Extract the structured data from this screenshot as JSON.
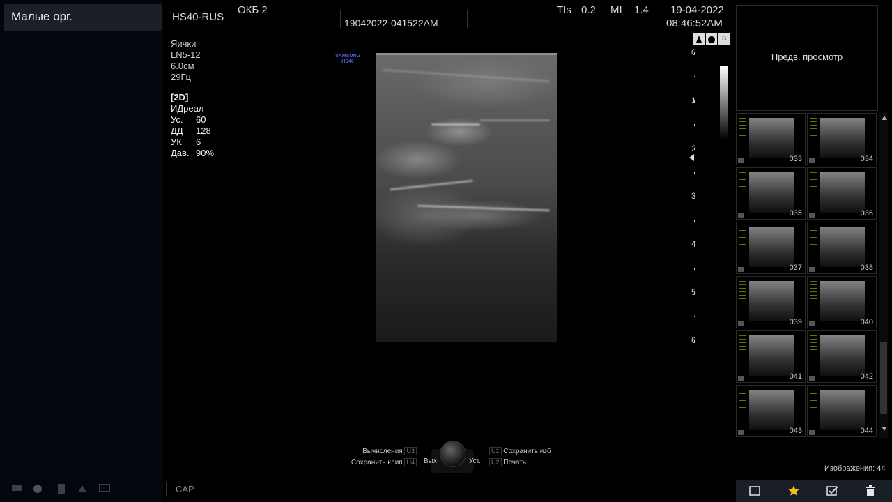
{
  "preset": "Малые орг.",
  "header": {
    "device": "HS40-RUS",
    "institution": "ОКБ 2",
    "patient_id": "19042022-041522AM",
    "tis_label": "TIs",
    "tis_value": "0.2",
    "mi_label": "MI",
    "mi_value": "1.4",
    "date": "19-04-2022",
    "time": "08:46:52AM"
  },
  "probe_info": {
    "exam": "Яички",
    "probe": "LN5-12",
    "depth": "6.0см",
    "frame_rate": "29Гц"
  },
  "mode": {
    "title": "[2D]",
    "preset": "ИДреал",
    "rows": [
      {
        "label": "Ус.",
        "value": "60"
      },
      {
        "label": "ДД",
        "value": "128"
      },
      {
        "label": "УК",
        "value": "6"
      },
      {
        "label": "Дав.",
        "value": "90%"
      }
    ]
  },
  "logo": {
    "line1": "SAMSUNG",
    "line2": "HS40"
  },
  "depth_scale": {
    "labels": [
      "0",
      "1",
      "2",
      "3",
      "4",
      "5",
      "6"
    ],
    "focus_marker_depth": 2.2
  },
  "preview_label": "Предв. просмотр",
  "thumbnails": [
    "033",
    "034",
    "035",
    "036",
    "037",
    "038",
    "039",
    "040",
    "041",
    "042",
    "043",
    "044"
  ],
  "images_count_label": "Изображения: 44",
  "controls": {
    "calc": "Вычисления",
    "calc_key": "U3",
    "save_clip": "Сохранить клип",
    "save_clip_key": "U4",
    "exit": "Вых",
    "set": "Уст.",
    "save_image": "Сохранить изб",
    "save_image_key": "U1",
    "print": "Печать",
    "print_key": "U2"
  },
  "status": {
    "caps": "CAP"
  },
  "icons": {
    "toolbar": [
      "square-icon",
      "star-icon",
      "checkbox-icon",
      "trash-icon"
    ],
    "star_color": "#f0c21a"
  }
}
